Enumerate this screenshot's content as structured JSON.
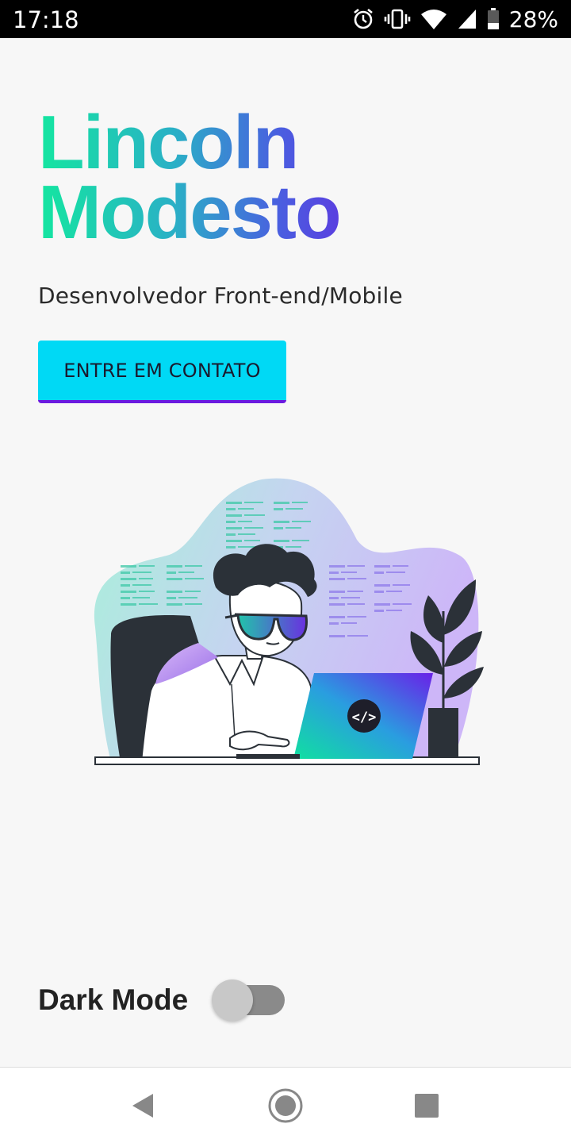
{
  "status_bar": {
    "time": "17:18",
    "battery_percent": "28%",
    "icons": [
      "alarm-icon",
      "vibrate-icon",
      "wifi-icon",
      "signal-icon",
      "battery-icon"
    ]
  },
  "profile": {
    "first_name": "Lincoln",
    "last_name": "Modesto",
    "subtitle": "Desenvolvedor Front-end/Mobile",
    "cta_label": "ENTRE EM CONTATO",
    "illustration_icon": "developer-illustration-icon",
    "laptop_badge": "</>"
  },
  "settings": {
    "dark_mode_label": "Dark Mode",
    "dark_mode_on": false
  },
  "nav_bar": {
    "icons": [
      "back-icon",
      "home-icon",
      "recents-icon"
    ]
  },
  "colors": {
    "name_gradient_start": "#14e6a0",
    "name_gradient_end": "#5a3fe0",
    "cta_background": "#00d9f5",
    "cta_underline": "#6a1be0",
    "background": "#f7f7f7"
  }
}
